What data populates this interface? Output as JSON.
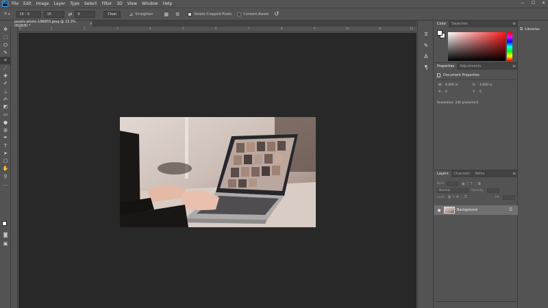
{
  "app": {
    "logo": "Ps"
  },
  "menu": [
    "File",
    "Edit",
    "Image",
    "Layer",
    "Type",
    "Select",
    "Filter",
    "3D",
    "View",
    "Window",
    "Help"
  ],
  "window_controls": [
    "—",
    "☐",
    "✕"
  ],
  "options": {
    "ratio": "16 : 9",
    "width_value": "16",
    "height_value": "9",
    "clear_label": "Clear",
    "straighten_label": "Straighten",
    "delete_cropped": {
      "label": "Delete Cropped Pixels",
      "checked": true
    },
    "content_aware": {
      "label": "Content-Aware",
      "checked": false
    }
  },
  "document": {
    "tab_title": "pexels-photo-196655.jpeg @ 33.3% (RGB/8) *",
    "ruler_ticks": [
      "0",
      "1",
      "2",
      "3",
      "4",
      "5",
      "6",
      "7",
      "8",
      "9",
      "10",
      "11",
      "12"
    ]
  },
  "panels": {
    "color": {
      "tabs": [
        "Color",
        "Swatches"
      ]
    },
    "properties": {
      "tabs": [
        "Properties",
        "Adjustments"
      ],
      "title": "Document Properties",
      "w_label": "W:",
      "w_value": "6.000 in",
      "h_label": "H:",
      "h_value": "4.000 in",
      "x_label": "X:",
      "x_value": "0",
      "y_label": "Y:",
      "y_value": "0",
      "resolution": "Resolution: 240 pixels/inch"
    },
    "layers": {
      "tabs": [
        "Layers",
        "Channels",
        "Paths"
      ],
      "kind_label": "Kind",
      "blend_label": "Normal",
      "opacity_label": "Opacity:",
      "lock_label": "Lock:",
      "fill_label": "Fill:",
      "layer_name": "Background"
    }
  },
  "libraries": {
    "label": "Libraries"
  }
}
